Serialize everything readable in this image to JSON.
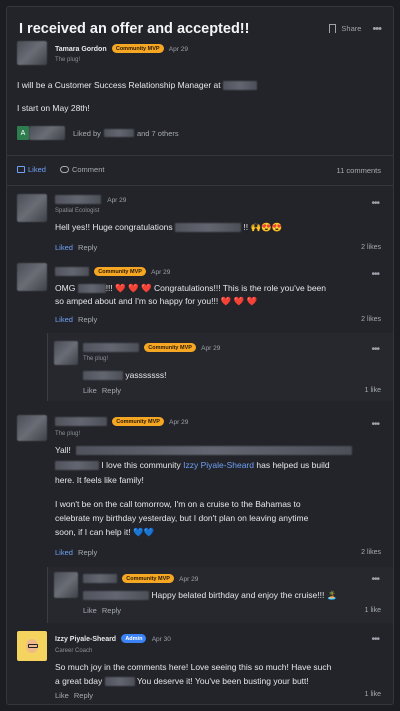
{
  "post": {
    "title": "I received an offer and accepted!!",
    "share_label": "Share",
    "author": "Tamara Gordon",
    "author_badge": "Community MVP",
    "date": "Apr 29",
    "author_sub": "The plug!",
    "line1": "I will be a Customer Success Relationship Manager at",
    "line2": "I start on May 28th!",
    "liked_by_prefix": "Liked by",
    "liked_by_suffix": "and 7 others",
    "liked_avatar_letter": "A"
  },
  "actions": {
    "liked_label": "Liked",
    "comment_label": "Comment",
    "comments_count": "11 comments"
  },
  "comments": [
    {
      "date": "Apr 29",
      "sub": "Spatial Ecologist",
      "text_a": "Hell yes!! Huge congratulations",
      "text_b": "!! 🙌😍😍",
      "like": "Liked",
      "reply": "Reply",
      "likes": "2 likes"
    },
    {
      "badge": "Community MVP",
      "date": "Apr 29",
      "text_a": "OMG",
      "text_b": "!!! ❤️ ❤️ ❤️ Congratulations!!! This is the role you've been",
      "text_c": "so amped about and I'm so happy for you!!! ❤️ ❤️ ❤️",
      "like": "Liked",
      "reply": "Reply",
      "likes": "2 likes"
    },
    {
      "badge": "Community MVP",
      "date": "Apr 29",
      "sub": "The plug!",
      "text": "yasssssss!",
      "like": "Like",
      "reply": "Reply",
      "likes": "1 like"
    },
    {
      "badge": "Community MVP",
      "date": "Apr 29",
      "sub": "The plug!",
      "text_yall": "Yall!",
      "text_love_a": "I love this community",
      "mention": "Izzy Piyale-Sheard",
      "text_love_b": "has helped us build",
      "text_here": "here. It feels like family!",
      "p2_1": "I won't be on the call tomorrow, I'm on a cruise to the Bahamas to",
      "p2_2": "celebrate my birthday yesterday, but I don't plan on leaving anytime",
      "p2_3": "soon, if I can help it! 💙💙",
      "like": "Liked",
      "reply": "Reply",
      "likes": "2 likes"
    },
    {
      "badge": "Community MVP",
      "date": "Apr 29",
      "text": "Happy belated birthday and enjoy the cruise!!! 🏝️",
      "like": "Like",
      "reply": "Reply",
      "likes": "1 like"
    },
    {
      "name": "Izzy Piyale-Sheard",
      "badge": "Admin",
      "date": "Apr 30",
      "sub": "Career Coach",
      "line1": "So much joy in the comments here! Love seeing this so much! Have such",
      "line2_a": "a great bday",
      "line2_b": "You deserve it! You've been busting your butt!",
      "like": "Like",
      "reply": "Reply",
      "likes": "1 like"
    }
  ],
  "colors": {
    "accent": "#6fa0f5",
    "badge": "#f5a623",
    "admin": "#3b82f6"
  },
  "icons": [
    "bookmark-icon",
    "more-icon",
    "like-icon",
    "comment-icon"
  ]
}
